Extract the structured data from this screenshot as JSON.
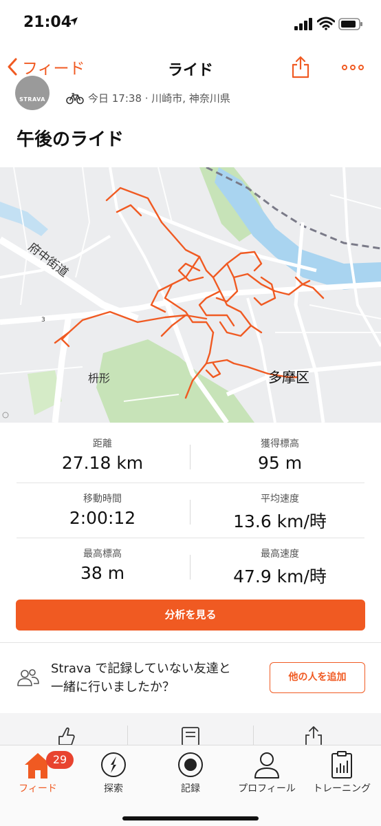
{
  "status": {
    "time": "21:04"
  },
  "nav": {
    "back_label": "フィード",
    "title": "ライド"
  },
  "activity": {
    "avatar_text": "STRAVA",
    "meta": "今日 17:38 · 川崎市, 神奈川県",
    "title": "午後のライド"
  },
  "map": {
    "labels": {
      "road": "府中街道",
      "area1": "枡形",
      "area2": "多摩区",
      "route_no": "3"
    },
    "route_color": "#f05a22",
    "water_color": "#a9d4f0",
    "park_color": "#c7e3b8"
  },
  "stats": [
    {
      "left": {
        "label": "距離",
        "value": "27.18 km"
      },
      "right": {
        "label": "獲得標高",
        "value": "95 m"
      }
    },
    {
      "left": {
        "label": "移動時間",
        "value": "2:00:12"
      },
      "right": {
        "label": "平均速度",
        "value": "13.6 km/時"
      }
    },
    {
      "left": {
        "label": "最高標高",
        "value": "38 m"
      },
      "right": {
        "label": "最高速度",
        "value": "47.9 km/時"
      }
    }
  ],
  "analyze_button": "分析を見る",
  "friends": {
    "line1": "Strava で記録していない友達と",
    "line2": "一緒に行いましたか？",
    "add_button": "他の人を追加"
  },
  "tabs": [
    {
      "label": "フィード",
      "icon": "home-icon",
      "badge": "29",
      "active": true
    },
    {
      "label": "探索",
      "icon": "compass-icon"
    },
    {
      "label": "記録",
      "icon": "record-icon"
    },
    {
      "label": "プロフィール",
      "icon": "profile-icon"
    },
    {
      "label": "トレーニング",
      "icon": "training-icon"
    }
  ],
  "colors": {
    "accent": "#f05a22",
    "badge": "#e8432f"
  }
}
